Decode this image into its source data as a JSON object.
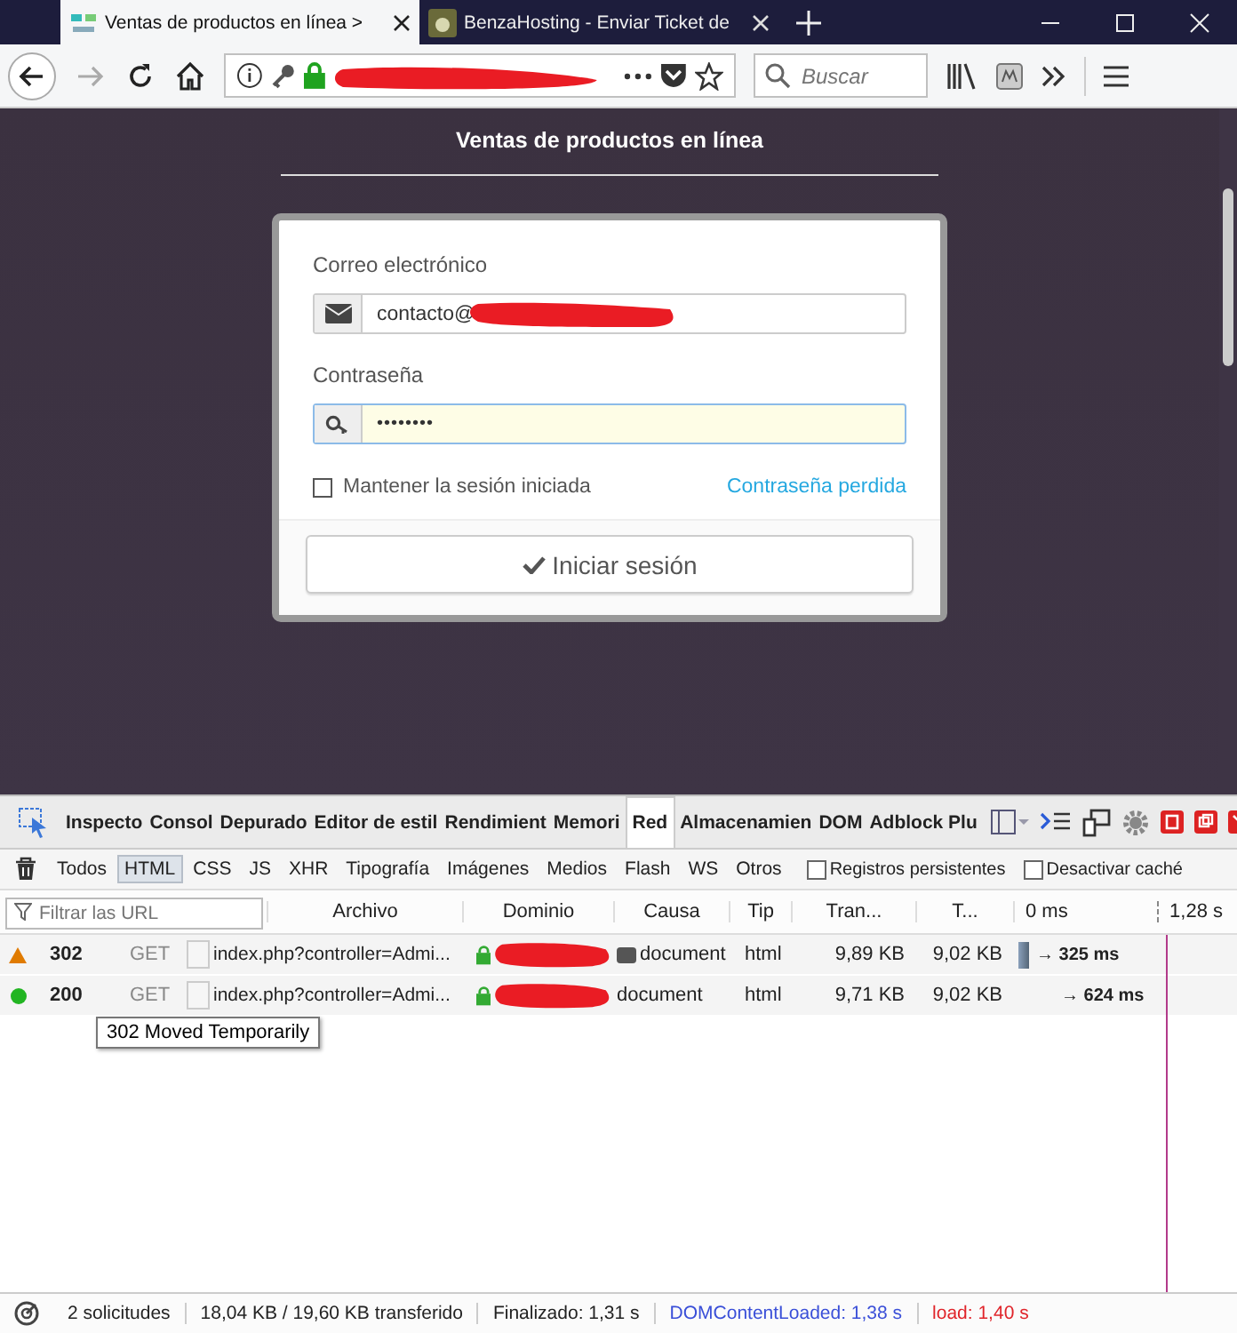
{
  "browser": {
    "tabs": [
      {
        "title": "Ventas de productos en línea >",
        "selected": true
      },
      {
        "title": "BenzaHosting - Enviar Ticket de",
        "selected": false
      }
    ],
    "search_placeholder": "Buscar"
  },
  "page": {
    "title": "Ventas de productos en línea",
    "form": {
      "email_label": "Correo electrónico",
      "email_value": "contacto@",
      "password_label": "Contraseña",
      "password_value": "••••••••",
      "remember_label": "Mantener la sesión iniciada",
      "remember_checked": false,
      "lost_password_link": "Contraseña perdida",
      "submit": "Iniciar sesión"
    }
  },
  "devtools": {
    "tabs": [
      {
        "label": "Inspecto",
        "selected": false
      },
      {
        "label": "Consol",
        "selected": false
      },
      {
        "label": "Depurado",
        "selected": false
      },
      {
        "label": "Editor de estil",
        "selected": false
      },
      {
        "label": "Rendimient",
        "selected": false
      },
      {
        "label": "Memori",
        "selected": false
      },
      {
        "label": "Red",
        "selected": true
      },
      {
        "label": "Almacenamien",
        "selected": false
      },
      {
        "label": "DOM",
        "selected": false
      },
      {
        "label": "Adblock Plu",
        "selected": false
      }
    ],
    "filters": [
      {
        "label": "Todos",
        "selected": false
      },
      {
        "label": "HTML",
        "selected": true
      },
      {
        "label": "CSS",
        "selected": false
      },
      {
        "label": "JS",
        "selected": false
      },
      {
        "label": "XHR",
        "selected": false
      },
      {
        "label": "Tipografía",
        "selected": false
      },
      {
        "label": "Imágenes",
        "selected": false
      },
      {
        "label": "Medios",
        "selected": false
      },
      {
        "label": "Flash",
        "selected": false
      },
      {
        "label": "WS",
        "selected": false
      },
      {
        "label": "Otros",
        "selected": false
      }
    ],
    "options": [
      {
        "label": "Registros persistentes",
        "checked": false
      },
      {
        "label": "Desactivar caché",
        "checked": false
      }
    ],
    "filter_placeholder": "Filtrar las URL",
    "columns": [
      "Archivo",
      "Dominio",
      "Causa",
      "Tip",
      "Tran...",
      "T..."
    ],
    "timeline_start": "0 ms",
    "timeline_marker": "1,28 s",
    "requests": [
      {
        "kind": "redirect",
        "color": "#e07b00",
        "status": "302",
        "method": "GET",
        "file": "index.php?controller=Admi...",
        "cause": "document",
        "script_badge": true,
        "type": "html",
        "transferred": "9,89 KB",
        "size": "9,02 KB",
        "timing_bar": true,
        "duration": "→ 325 ms"
      },
      {
        "kind": "ok",
        "color": "#22b522",
        "status": "200",
        "method": "GET",
        "file": "index.php?controller=Admi...",
        "cause": "document",
        "script_badge": false,
        "type": "html",
        "transferred": "9,71 KB",
        "size": "9,02 KB",
        "timing_bar": false,
        "duration": "→ 624 ms"
      }
    ],
    "tooltip": "302 Moved Temporarily",
    "status_bar": [
      {
        "kind": "plain",
        "text": "2 solicitudes"
      },
      {
        "kind": "plain",
        "text": "18,04 KB / 19,60 KB transferido"
      },
      {
        "kind": "plain",
        "text": "Finalizado: 1,31 s"
      },
      {
        "kind": "domcontentloaded",
        "text": "DOMContentLoaded: 1,38 s"
      },
      {
        "kind": "load",
        "text": "load: 1,40 s"
      }
    ]
  }
}
